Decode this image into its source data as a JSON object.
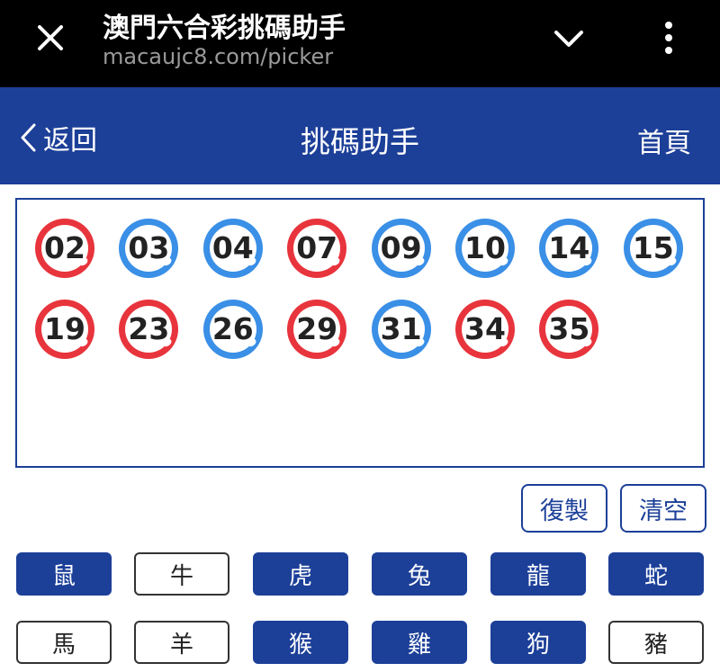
{
  "browser": {
    "title": "澳門六合彩挑碼助手",
    "url": "macaujc8.com/picker"
  },
  "header": {
    "back_label": "返回",
    "title": "挑碼助手",
    "home_label": "首頁"
  },
  "colors": {
    "primary": "#1c3f98",
    "red_ball": "#e8343c",
    "blue_ball": "#3a8fe6"
  },
  "balls": [
    {
      "num": "02",
      "color": "red"
    },
    {
      "num": "03",
      "color": "blue"
    },
    {
      "num": "04",
      "color": "blue"
    },
    {
      "num": "07",
      "color": "red"
    },
    {
      "num": "09",
      "color": "blue"
    },
    {
      "num": "10",
      "color": "blue"
    },
    {
      "num": "14",
      "color": "blue"
    },
    {
      "num": "15",
      "color": "blue"
    },
    {
      "num": "19",
      "color": "red"
    },
    {
      "num": "23",
      "color": "red"
    },
    {
      "num": "26",
      "color": "blue"
    },
    {
      "num": "29",
      "color": "red"
    },
    {
      "num": "31",
      "color": "blue"
    },
    {
      "num": "34",
      "color": "red"
    },
    {
      "num": "35",
      "color": "red"
    }
  ],
  "actions": {
    "copy_label": "復製",
    "clear_label": "清空"
  },
  "zodiacs": [
    {
      "label": "鼠",
      "selected": true
    },
    {
      "label": "牛",
      "selected": false
    },
    {
      "label": "虎",
      "selected": true
    },
    {
      "label": "兔",
      "selected": true
    },
    {
      "label": "龍",
      "selected": true
    },
    {
      "label": "蛇",
      "selected": true
    },
    {
      "label": "馬",
      "selected": false
    },
    {
      "label": "羊",
      "selected": false
    },
    {
      "label": "猴",
      "selected": true
    },
    {
      "label": "雞",
      "selected": true
    },
    {
      "label": "狗",
      "selected": true
    },
    {
      "label": "豬",
      "selected": false
    }
  ]
}
